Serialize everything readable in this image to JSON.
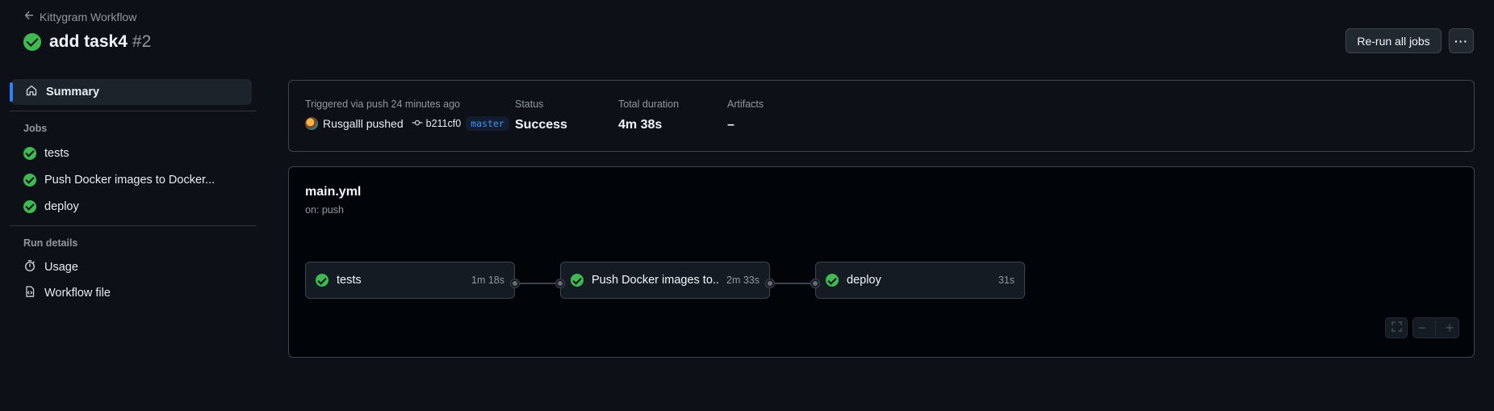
{
  "header": {
    "back_label": "Kittygram Workflow",
    "title": "add task4",
    "run_number": "#2",
    "rerun_label": "Re-run all jobs",
    "more_label": "···"
  },
  "sidebar": {
    "summary_label": "Summary",
    "jobs_heading": "Jobs",
    "jobs": [
      {
        "label": "tests",
        "status": "success"
      },
      {
        "label": "Push Docker images to Docker...",
        "status": "success"
      },
      {
        "label": "deploy",
        "status": "success"
      }
    ],
    "run_details_heading": "Run details",
    "usage_label": "Usage",
    "workflow_file_label": "Workflow file"
  },
  "summary": {
    "trigger_label": "Triggered via push 24 minutes ago",
    "actor": "Rusgalll pushed",
    "commit_sha": "b211cf0",
    "branch": "master",
    "status_label": "Status",
    "status_value": "Success",
    "duration_label": "Total duration",
    "duration_value": "4m 38s",
    "artifacts_label": "Artifacts",
    "artifacts_value": "–"
  },
  "graph": {
    "file": "main.yml",
    "trigger": "on: push",
    "jobs": [
      {
        "name": "tests",
        "time": "1m 18s"
      },
      {
        "name": "Push Docker images to...",
        "time": "2m 33s"
      },
      {
        "name": "deploy",
        "time": "31s"
      }
    ],
    "zoom_out": "−",
    "zoom_in": "+"
  },
  "colors": {
    "success": "#3fb950",
    "accent": "#2f81f7",
    "background": "#0d1117"
  }
}
